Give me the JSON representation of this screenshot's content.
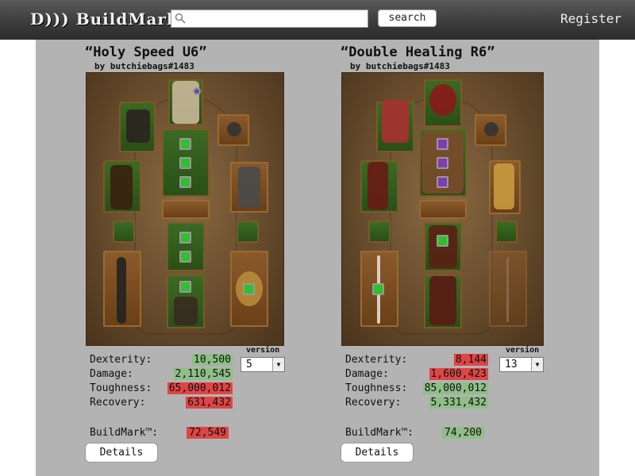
{
  "header": {
    "logo_text": "D))) BuildMark",
    "search_value": "",
    "search_button": "search",
    "register_link": "Register"
  },
  "builds": [
    {
      "title": "“Holy Speed U6”",
      "author": "by butchiebags#1483",
      "stats": [
        {
          "label": "Dexterity:",
          "value": "10,500",
          "status": "good"
        },
        {
          "label": "Damage:",
          "value": "2,110,545",
          "status": "good"
        },
        {
          "label": "Toughness:",
          "value": "65,000,012",
          "status": "bad"
        },
        {
          "label": "Recovery:",
          "value": "631,432",
          "status": "bad"
        }
      ],
      "version_label": "version",
      "version_value": "5",
      "buildmark_label": "BuildMark™:",
      "buildmark_value": "72,549",
      "buildmark_status": "bad",
      "details_button": "Details"
    },
    {
      "title": "“Double Healing R6”",
      "author": "by butchiebags#1483",
      "stats": [
        {
          "label": "Dexterity:",
          "value": "8,144",
          "status": "bad"
        },
        {
          "label": "Damage:",
          "value": "1,600,423",
          "status": "bad"
        },
        {
          "label": "Toughness:",
          "value": "85,000,012",
          "status": "good"
        },
        {
          "label": "Recovery:",
          "value": "5,331,432",
          "status": "good"
        }
      ],
      "version_label": "version",
      "version_value": "13",
      "buildmark_label": "BuildMark™:",
      "buildmark_value": "74,200",
      "buildmark_status": "good",
      "details_button": "Details"
    }
  ],
  "colors": {
    "good": "#8fbf86",
    "bad": "#e04545",
    "panel": "#b3b3b3",
    "header": "#3a3a3a"
  }
}
